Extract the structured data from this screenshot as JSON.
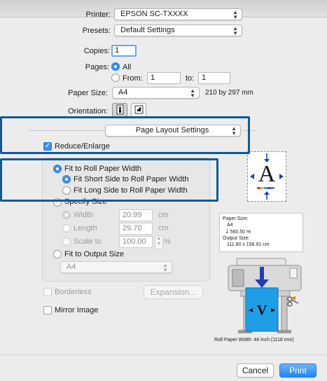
{
  "printer": {
    "label": "Printer:",
    "value": "EPSON SC-TXXXX"
  },
  "presets": {
    "label": "Presets:",
    "value": "Default Settings"
  },
  "copies": {
    "label": "Copies:",
    "value": "1"
  },
  "pages": {
    "label": "Pages:",
    "all_label": "All",
    "from_label": "From:",
    "from_value": "1",
    "to_label": "to:",
    "to_value": "1"
  },
  "paper_size": {
    "label": "Paper Size:",
    "value": "A4",
    "dims": "210 by 297 mm"
  },
  "orientation": {
    "label": "Orientation:"
  },
  "panel": {
    "value": "Page Layout Settings"
  },
  "reduce_enlarge": {
    "label": "Reduce/Enlarge",
    "checked": true
  },
  "fit_roll": {
    "label": "Fit to Roll Paper Width",
    "short_side": "Fit Short Side to Roll Paper Width",
    "long_side": "Fit Long Side to Roll Paper Width"
  },
  "specify_size": {
    "label": "Specify Size",
    "width_label": "Width",
    "width_value": "20.99",
    "length_label": "Length",
    "length_value": "29.70",
    "scale_label": "Scale to",
    "scale_value": "100.00",
    "unit": "cm",
    "percent": "%"
  },
  "fit_output": {
    "label": "Fit to Output Size",
    "value": "A4"
  },
  "borderless": {
    "label": "Borderless"
  },
  "expansion": {
    "label": "Expansion..."
  },
  "mirror": {
    "label": "Mirror Image"
  },
  "preview": {
    "letter": "A",
    "paper_size_label": "Paper Size:",
    "paper_size_value": "A4",
    "scale_value": "560.50 %",
    "output_size_label": "Output Size:",
    "output_size_value": "111.80 x 156.91 cm",
    "roll_width": "Roll Paper Width:  44 inch (1118 mm)"
  },
  "buttons": {
    "cancel": "Cancel",
    "print": "Print"
  },
  "colors": {
    "accent": "#3b8ff3",
    "highlight_border": "#0f5a96",
    "printer_sheet": "#1e9ee6"
  }
}
